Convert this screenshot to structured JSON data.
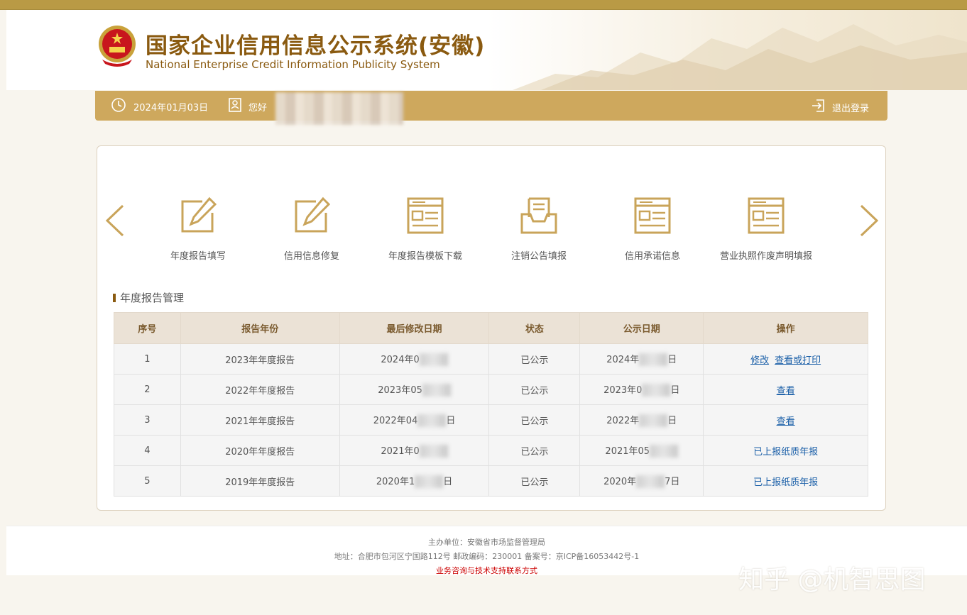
{
  "header": {
    "title": "国家企业信用信息公示系统(安徽)",
    "subtitle": "National Enterprise Credit Information Publicity System"
  },
  "userbar": {
    "date": "2024年01月03日",
    "greeting": "您好",
    "logout": "退出登录"
  },
  "shortcuts": [
    {
      "label": "年度报告填写",
      "icon": "edit-icon"
    },
    {
      "label": "信用信息修复",
      "icon": "edit-icon"
    },
    {
      "label": "年度报告模板下载",
      "icon": "document-icon"
    },
    {
      "label": "注销公告填报",
      "icon": "inbox-icon"
    },
    {
      "label": "信用承诺信息",
      "icon": "document-icon"
    },
    {
      "label": "营业执照作废声明填报",
      "icon": "document-icon"
    }
  ],
  "section": {
    "title": "年度报告管理"
  },
  "table": {
    "headers": [
      "序号",
      "报告年份",
      "最后修改日期",
      "状态",
      "公示日期",
      "操作"
    ],
    "rows": [
      {
        "no": "1",
        "year": "2023年年度报告",
        "modified_prefix": "2024年0",
        "modified_suffix": "",
        "status": "已公示",
        "published_prefix": "2024年",
        "published_suffix": "日"
      },
      {
        "no": "2",
        "year": "2022年年度报告",
        "modified_prefix": "2023年05",
        "modified_suffix": "",
        "status": "已公示",
        "published_prefix": "2023年0",
        "published_suffix": "日"
      },
      {
        "no": "3",
        "year": "2021年年度报告",
        "modified_prefix": "2022年04",
        "modified_suffix": "日",
        "status": "已公示",
        "published_prefix": "2022年",
        "published_suffix": "日"
      },
      {
        "no": "4",
        "year": "2020年年度报告",
        "modified_prefix": "2021年0",
        "modified_suffix": "",
        "status": "已公示",
        "published_prefix": "2021年05",
        "published_suffix": ""
      },
      {
        "no": "5",
        "year": "2019年年度报告",
        "modified_prefix": "2020年1",
        "modified_suffix": "日",
        "status": "已公示",
        "published_prefix": "2020年",
        "published_suffix": "7日"
      }
    ],
    "ops": {
      "modify": "修改",
      "view_print": "查看或打印",
      "view": "查看",
      "paper": "已上报纸质年报"
    }
  },
  "footer": {
    "sponsor": "主办单位：安徽省市场监督管理局",
    "address": "地址：合肥市包河区宁国路112号 邮政编码：230001 备案号：京ICP备16053442号-1",
    "support": "业务咨询与技术支持联系方式"
  },
  "watermark": "知乎 @机智思图",
  "colors": {
    "gold": "#cea85d",
    "brown": "#8a5a10",
    "link": "#1a5fa8"
  }
}
